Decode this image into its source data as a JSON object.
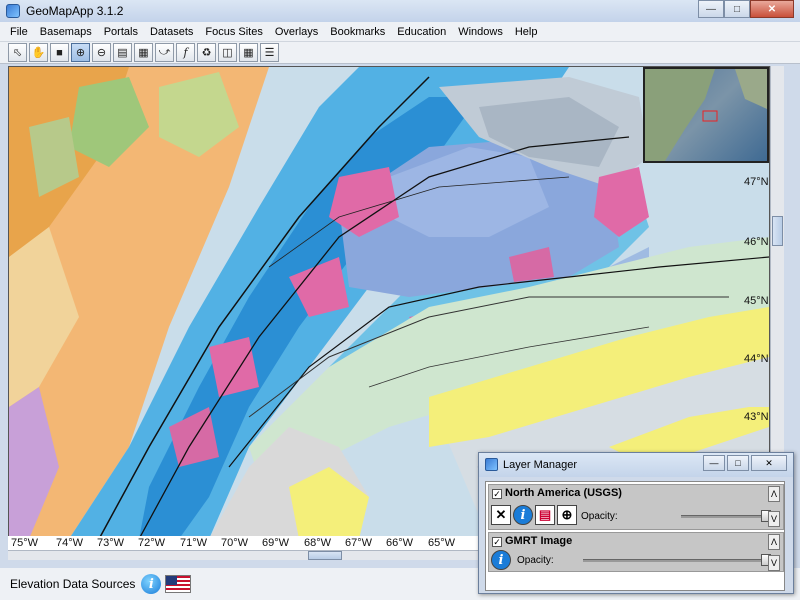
{
  "window": {
    "title": "GeoMapApp 3.1.2"
  },
  "menu": [
    "File",
    "Basemaps",
    "Portals",
    "Datasets",
    "Focus Sites",
    "Overlays",
    "Bookmarks",
    "Education",
    "Windows",
    "Help"
  ],
  "toolbar_icons": [
    "select-arrow-icon",
    "pan-hand-icon",
    "save-icon",
    "zoom-in-icon",
    "zoom-out-icon",
    "profile-icon",
    "grid-measure-icon",
    "lasso-icon",
    "fx-icon",
    "scale-icon",
    "frame-icon",
    "graticule-icon",
    "list-icon"
  ],
  "map": {
    "latitudes": [
      "47°N",
      "46°N",
      "45°N",
      "44°N",
      "43°N"
    ],
    "longitudes": [
      "75°W",
      "74°W",
      "73°W",
      "72°W",
      "71°W",
      "70°W",
      "69°W",
      "68°W",
      "67°W",
      "66°W",
      "65°W"
    ]
  },
  "status": {
    "label": "Elevation Data Sources"
  },
  "layer_manager": {
    "title": "Layer Manager",
    "layers": [
      {
        "name": "North America (USGS)",
        "checked": true,
        "opacity_label": "Opacity:",
        "opacity": 1.0
      },
      {
        "name": "GMRT Image",
        "checked": true,
        "opacity_label": "Opacity:",
        "opacity": 1.0
      }
    ]
  },
  "colors": {
    "ocean_light": "#c9ddea",
    "shelf_yellow": "#f4ef7a",
    "appalachian_blue": "#4aa8df",
    "granite_pink": "#e06aa7"
  }
}
